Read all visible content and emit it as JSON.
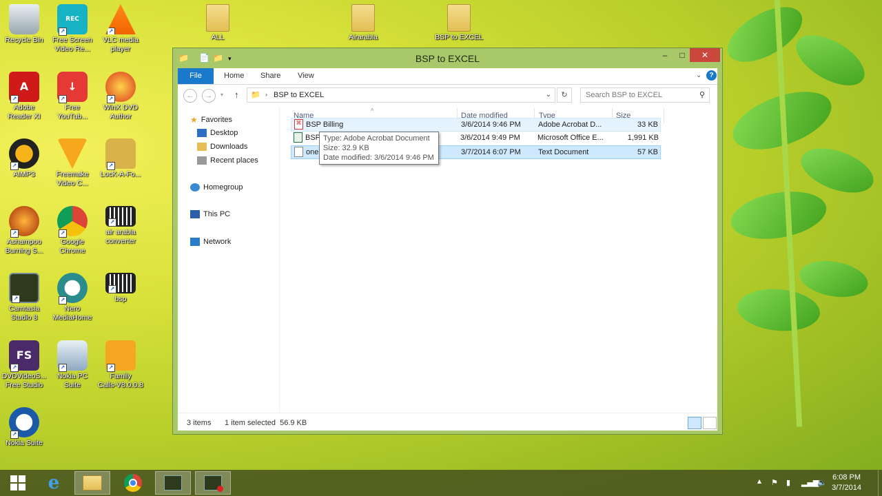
{
  "desktop": {
    "icons": [
      {
        "label": "Recycle Bin",
        "icon": "recycle-bin-icon"
      },
      {
        "label": "Free Screen\nVideo Re...",
        "icon": "screen-recorder-icon"
      },
      {
        "label": "VLC media\nplayer",
        "icon": "vlc-icon"
      },
      {
        "label": "Adobe\nReader XI",
        "icon": "adobe-reader-icon"
      },
      {
        "label": "Free\nYouTub...",
        "icon": "youtube-downloader-icon"
      },
      {
        "label": "WinX DVD\nAuthor",
        "icon": "winx-dvd-icon"
      },
      {
        "label": "AIMP3",
        "icon": "aimp-icon"
      },
      {
        "label": "Freemake\nVideo C...",
        "icon": "freemake-icon"
      },
      {
        "label": "LocK-A-Fo...",
        "icon": "lock-folder-icon"
      },
      {
        "label": "Ashampoo\nBurning S...",
        "icon": "ashampoo-icon"
      },
      {
        "label": "Google\nChrome",
        "icon": "chrome-icon"
      },
      {
        "label": "air arabia\nconverter",
        "icon": "video-file-icon"
      },
      {
        "label": "Camtasia\nStudio 8",
        "icon": "camtasia-icon"
      },
      {
        "label": "Nero\nMediaHome",
        "icon": "nero-icon"
      },
      {
        "label": "bsp",
        "icon": "video-file-icon"
      },
      {
        "label": "DVDVideoS...\nFree Studio",
        "icon": "dvdvideosoft-icon"
      },
      {
        "label": "Nokia PC\nSuite",
        "icon": "nokia-pc-suite-icon"
      },
      {
        "label": "Family\nCalls-V8.0.0.8",
        "icon": "family-calls-icon"
      },
      {
        "label": "Nokia Suite",
        "icon": "nokia-suite-icon"
      }
    ],
    "folders": [
      "ALL",
      "Airarabia",
      "BSP to EXCEL"
    ]
  },
  "window": {
    "title": "BSP to EXCEL",
    "ribbon_tabs": [
      "File",
      "Home",
      "Share",
      "View"
    ],
    "path": "BSP to EXCEL",
    "search_placeholder": "Search BSP to EXCEL",
    "nav": {
      "favorites": "Favorites",
      "desktop": "Desktop",
      "downloads": "Downloads",
      "recent": "Recent places",
      "homegroup": "Homegroup",
      "thispc": "This PC",
      "network": "Network"
    },
    "columns": [
      "Name",
      "Date modified",
      "Type",
      "Size"
    ],
    "files": [
      {
        "name": "BSP Billing",
        "date": "3/6/2014 9:46 PM",
        "type": "Adobe Acrobat D...",
        "size": "33 KB",
        "icon": "pdf-file-icon"
      },
      {
        "name": "BSP",
        "date": "3/6/2014 9:49 PM",
        "type": "Microsoft Office E...",
        "size": "1,991 KB",
        "icon": "excel-file-icon"
      },
      {
        "name": "one",
        "date": "3/7/2014 6:07 PM",
        "type": "Text Document",
        "size": "57 KB",
        "icon": "text-file-icon"
      }
    ],
    "tooltip": {
      "type": "Type: Adobe Acrobat Document",
      "size": "Size: 32.9 KB",
      "date": "Date modified: 3/6/2014 9:46 PM"
    },
    "status": {
      "items": "3 items",
      "selected": "1 item selected  56.9 KB"
    }
  },
  "taskbar": {
    "time": "6:08 PM",
    "date": "3/7/2014"
  }
}
